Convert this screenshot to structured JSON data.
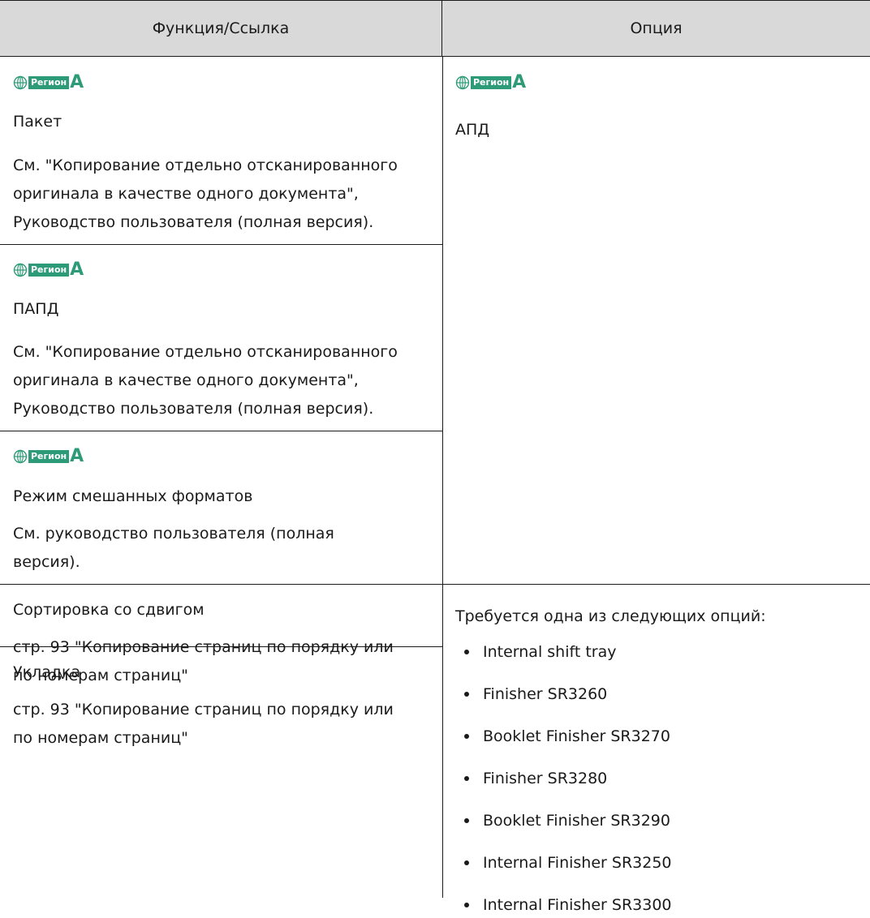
{
  "header": {
    "col_function": "Функция/Ссылка",
    "col_option": "Опция"
  },
  "region_badge": {
    "label": "Регион",
    "letter": "A",
    "icon": "globe-icon",
    "color": "#2e9b78"
  },
  "rows": [
    {
      "function_title": "Пакет",
      "reference": [
        "См. \"Копирование отдельно отсканированного",
        "оригинала в качестве одного документа\",",
        "Руководство пользователя (полная версия)."
      ]
    },
    {
      "function_title": "ПАПД",
      "reference": [
        "См. \"Копирование отдельно отсканированного",
        "оригинала в качестве одного документа\",",
        "Руководство пользователя (полная версия)."
      ]
    },
    {
      "function_title": "Режим смешанных форматов",
      "reference": [
        "См. руководство пользователя (полная",
        "версия)."
      ]
    },
    {
      "function_title": "Сортировка со сдвигом",
      "reference": [
        "стр. 93 \"Копирование страниц по порядку или",
        "по номерам страниц\""
      ]
    },
    {
      "function_title": "Укладка",
      "reference": [
        "стр. 93 \"Копирование страниц по порядку или",
        "по номерам страниц\""
      ]
    }
  ],
  "option_adf": "АПД",
  "option_required": {
    "intro": "Требуется одна из следующих опций:",
    "items": [
      "Internal shift tray",
      "Finisher SR3260",
      "Booklet Finisher SR3270",
      "Finisher SR3280",
      "Booklet Finisher SR3290",
      "Internal Finisher SR3250",
      "Internal Finisher SR3300"
    ]
  }
}
